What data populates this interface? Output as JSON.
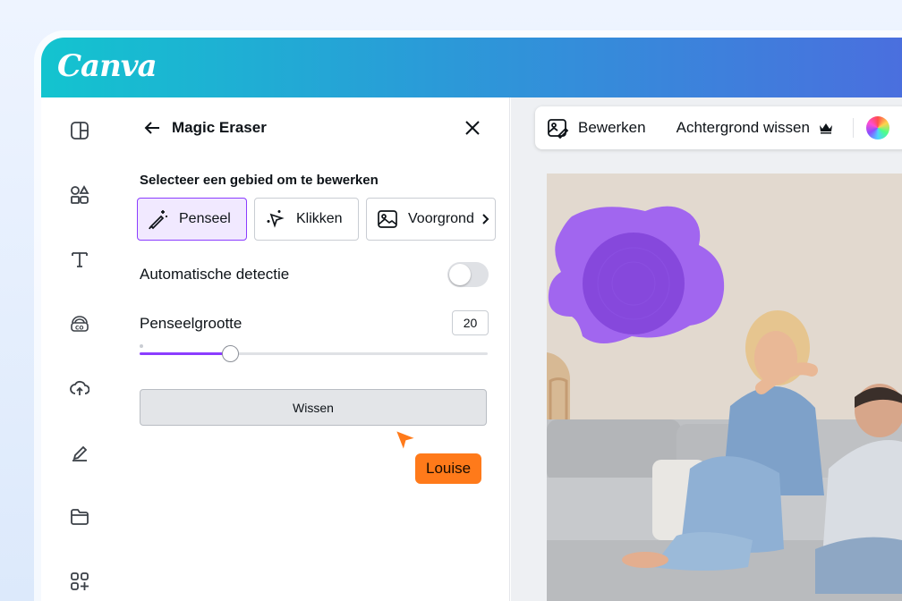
{
  "brand": {
    "logo": "Canva"
  },
  "rail": {
    "items": [
      "layout-icon",
      "elements-icon",
      "text-icon",
      "brand-icon",
      "upload-icon",
      "draw-icon",
      "projects-icon",
      "apps-icon"
    ]
  },
  "panel": {
    "title": "Magic Eraser",
    "section_label": "Selecteer een gebied om te bewerken",
    "modes": [
      {
        "label": "Penseel",
        "icon": "brush-icon",
        "active": true
      },
      {
        "label": "Klikken",
        "icon": "click-sparkle-icon",
        "active": false
      },
      {
        "label": "Voorgrond",
        "icon": "image-icon",
        "active": false
      }
    ],
    "auto_detect_label": "Automatische detectie",
    "auto_detect_on": false,
    "brush_size_label": "Penseelgrootte",
    "brush_size_value": "20",
    "brush_size_fraction": 0.26,
    "clear_button": "Wissen"
  },
  "collaborator": {
    "name": "Louise",
    "color": "#ff7a1a"
  },
  "toolbar": {
    "edit_label": "Bewerken",
    "remove_bg_label": "Achtergrond wissen"
  },
  "colors": {
    "accent": "#8b3dff",
    "brush_overlay": "#9b5cf2"
  }
}
